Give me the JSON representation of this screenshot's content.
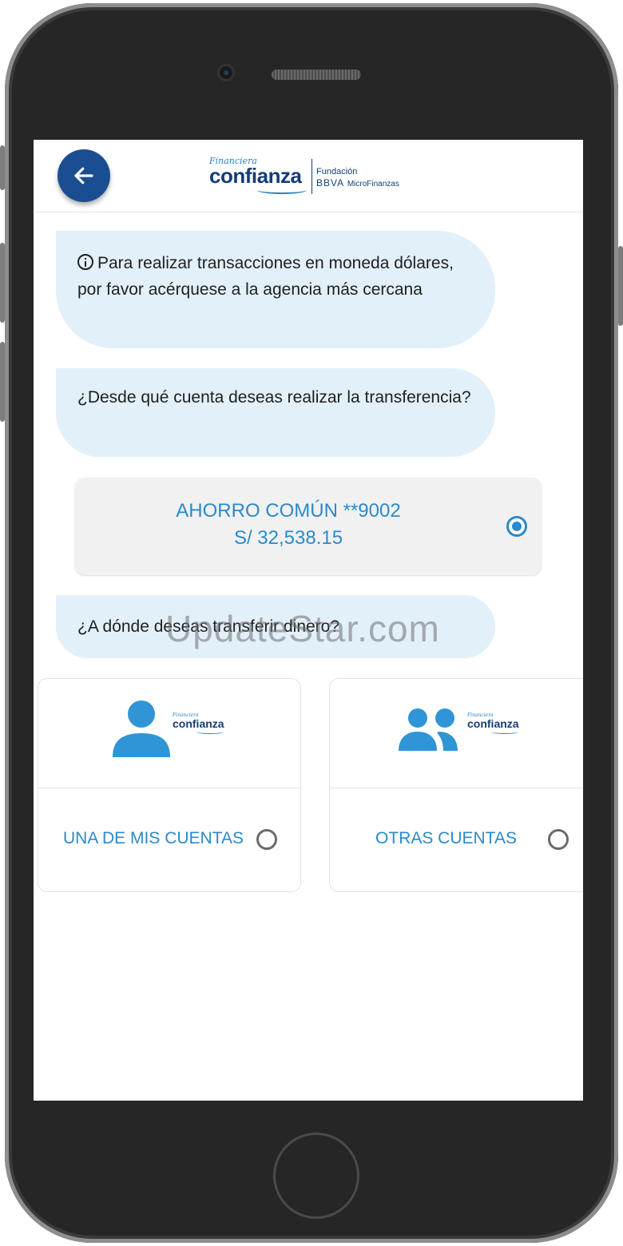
{
  "header": {
    "logo": {
      "small_text": "Financiera",
      "brand": "confianza",
      "fundacion": "Fundación",
      "bbva": "BBVA",
      "microfinanzas": "MicroFinanzas"
    }
  },
  "chat": {
    "info_message": "Para realizar transacciones en moneda dólares, por favor acérquese a la agencia más cercana",
    "question_origin": "¿Desde qué cuenta deseas realizar la transferencia?",
    "question_destination": "¿A dónde deseas transferir dinero?"
  },
  "account": {
    "name": "AHORRO COMÚN **9002",
    "balance": "S/ 32,538.15",
    "selected": true
  },
  "options": [
    {
      "label": "UNA DE MIS CUENTAS",
      "icon": "person-icon",
      "logo_small": "Financiera",
      "logo_brand": "confianza",
      "selected": false
    },
    {
      "label": "OTRAS CUENTAS",
      "icon": "people-icon",
      "logo_small": "Financiera",
      "logo_brand": "confianza",
      "selected": false
    }
  ],
  "watermark": "UpdateStar.com",
  "colors": {
    "primary": "#1a4e93",
    "accent": "#2a8acb",
    "bubble": "#e2f0fa",
    "brand_dark": "#143c78"
  }
}
